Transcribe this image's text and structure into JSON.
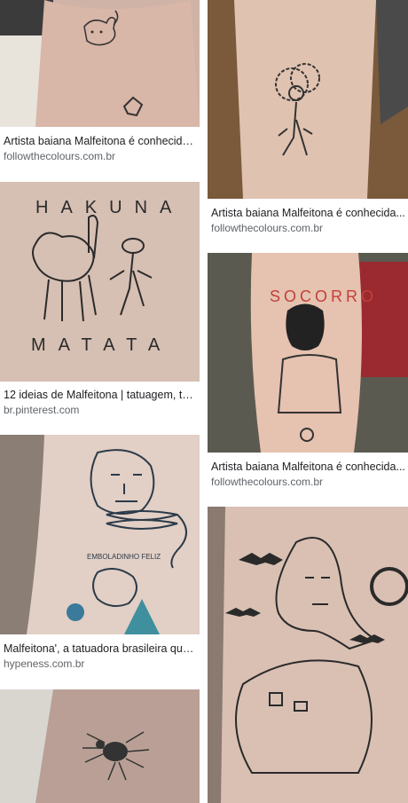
{
  "results": [
    {
      "title": "Artista baiana Malfeitona é conhecida...",
      "domain": "followthecolours.com.br",
      "image": "cat-tattoo"
    },
    {
      "title": "Artista baiana Malfeitona é conhecida...",
      "domain": "followthecolours.com.br",
      "image": "curly-hair-figure-tattoo"
    },
    {
      "title": "12 ideias de Malfeitona | tatuagem, ta...",
      "domain": "br.pinterest.com",
      "image": "hakuna-matata-tattoo",
      "tattoo_text_top": "HAKUNA",
      "tattoo_text_bottom": "MATATA"
    },
    {
      "title": "Artista baiana Malfeitona é conhecida...",
      "domain": "followthecolours.com.br",
      "image": "socorro-man-tattoo",
      "tattoo_text": "SOCORRO"
    },
    {
      "title": "Malfeitona', a tatuadora brasileira que...",
      "domain": "hypeness.com.br",
      "image": "face-snake-tattoo",
      "tattoo_text": "EMBOLADINHO FELIZ"
    },
    {
      "title": "",
      "domain": "",
      "image": "spider-tattoo"
    },
    {
      "title": "",
      "domain": "",
      "image": "mona-lisa-bats-tattoo"
    }
  ]
}
